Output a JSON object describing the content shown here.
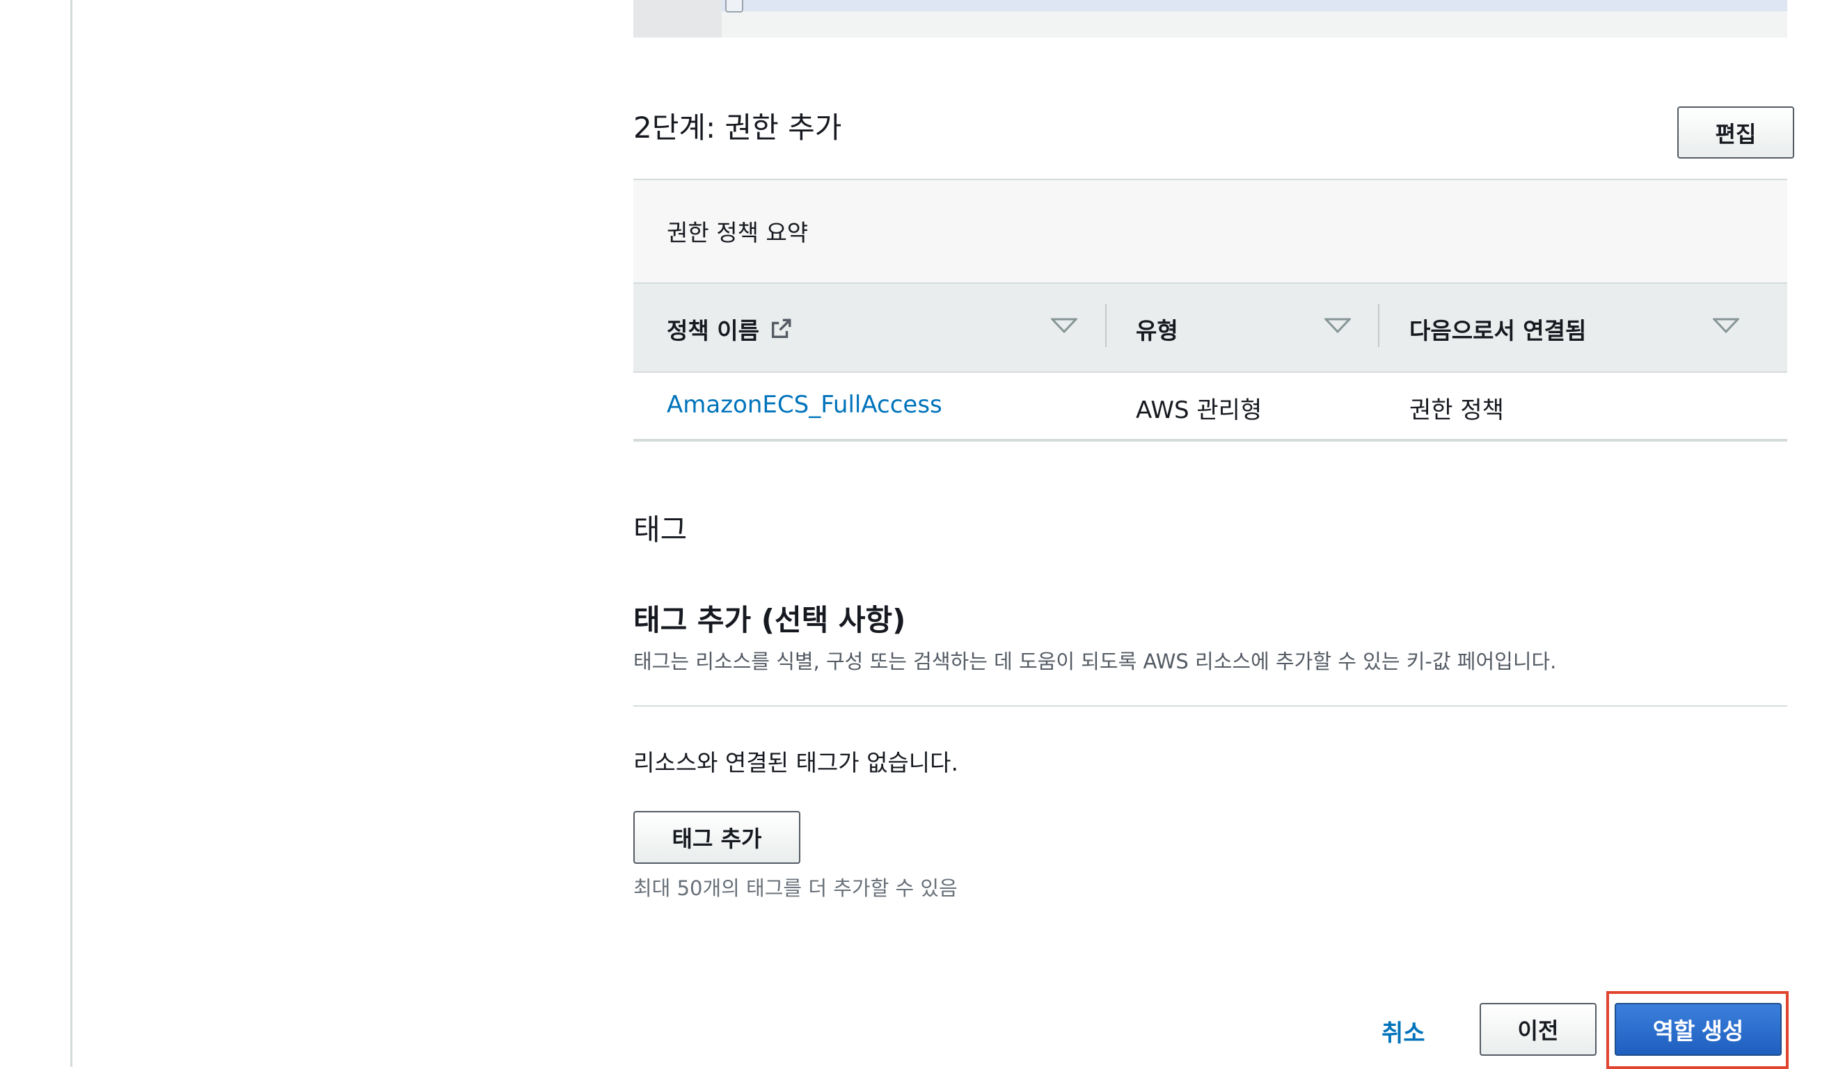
{
  "step2": {
    "title": "2단계: 권한 추가",
    "edit_label": "편집"
  },
  "permissions_summary": {
    "title": "권한 정책 요약",
    "columns": [
      "정책 이름",
      "유형",
      "다음으로서 연결됨"
    ],
    "rows": [
      {
        "policy_name": "AmazonECS_FullAccess",
        "type": "AWS 관리형",
        "attached_as": "권한 정책"
      }
    ]
  },
  "tags": {
    "section_title": "태그",
    "add_title": "태그 추가 (선택 사항)",
    "description": "태그는 리소스를 식별, 구성 또는 검색하는 데 도움이 되도록 AWS 리소스에 추가할 수 있는 키-값 페어입니다.",
    "empty_message": "리소스와 연결된 태그가 없습니다.",
    "add_button": "태그 추가",
    "limit_note": "최대 50개의 태그를 더 추가할 수 있음"
  },
  "footer": {
    "cancel_label": "취소",
    "previous_label": "이전",
    "create_label": "역할 생성"
  },
  "colors": {
    "link": "#0073bb",
    "primary": "#1f5fbf",
    "highlight": "#e0452f"
  },
  "icons": [
    "external-link-icon",
    "sort-caret-icon"
  ]
}
